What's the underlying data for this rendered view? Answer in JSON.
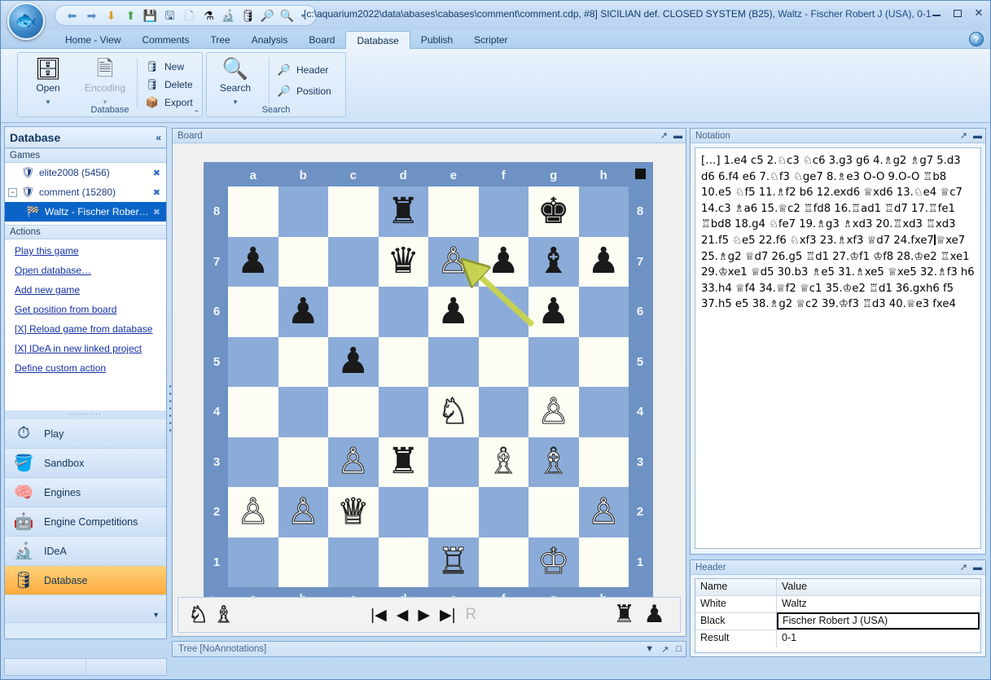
{
  "window": {
    "title_path": "[c:\\aquarium2022\\data\\abases\\cabases\\comment\\comment.cdp, #8] SICILIAN def. CLOSED SYSTEM (B25),",
    "title_players": "Waltz - Fischer Robert J (USA), 0-1",
    "minimize": "–",
    "maximize": "□",
    "close": "✕"
  },
  "quick_access": {
    "icons": [
      {
        "name": "back-arrow-icon",
        "glyph": "⬅"
      },
      {
        "name": "forward-arrow-icon",
        "glyph": "➡"
      },
      {
        "name": "download-arrow-icon",
        "glyph": "⬇"
      },
      {
        "name": "upload-arrow-icon",
        "glyph": "⬆"
      },
      {
        "name": "save-icon",
        "glyph": "💾"
      },
      {
        "name": "save-as-icon",
        "glyph": "🖫"
      },
      {
        "name": "new-document-icon",
        "glyph": "🗋"
      },
      {
        "name": "chart-flask-icon",
        "glyph": "⚗"
      },
      {
        "name": "microscope-icon",
        "glyph": "🔬"
      },
      {
        "name": "database-icon",
        "glyph": "🛢"
      },
      {
        "name": "search-header-icon",
        "glyph": "🔎"
      },
      {
        "name": "search-ab-icon",
        "glyph": "🔍"
      }
    ],
    "dropdown_glyph": "▾"
  },
  "ribbon": {
    "tabs": [
      {
        "label": "Home - View",
        "active": false
      },
      {
        "label": "Comments",
        "active": false
      },
      {
        "label": "Tree",
        "active": false
      },
      {
        "label": "Analysis",
        "active": false
      },
      {
        "label": "Board",
        "active": false
      },
      {
        "label": "Database",
        "active": true
      },
      {
        "label": "Publish",
        "active": false
      },
      {
        "label": "Scripter",
        "active": false
      }
    ],
    "help_glyph": "?",
    "groups": [
      {
        "name": "Database",
        "title": "Database",
        "dialog_launcher": "⌁",
        "big_buttons": [
          {
            "label": "Open",
            "icon": "database-open-icon",
            "glyph": "🗄",
            "dropdown": "▾",
            "disabled": false
          },
          {
            "label": "Encoding",
            "icon": "encoding-icon",
            "glyph": "🗎",
            "dropdown": "▾",
            "disabled": true
          }
        ],
        "small_buttons": [
          {
            "label": "New",
            "icon": "new-database-icon",
            "glyph": "🛢"
          },
          {
            "label": "Delete",
            "icon": "delete-database-icon",
            "glyph": "🛢"
          },
          {
            "label": "Export",
            "icon": "export-icon",
            "glyph": "📦"
          }
        ]
      },
      {
        "name": "Search",
        "title": "Search",
        "big_buttons": [
          {
            "label": "Search",
            "icon": "search-magnifier-icon",
            "glyph": "🔍",
            "dropdown": "▾",
            "disabled": false
          }
        ],
        "small_buttons": [
          {
            "label": "Header",
            "icon": "search-header-icon",
            "glyph": "🔎"
          },
          {
            "label": "Position",
            "icon": "search-position-icon",
            "glyph": "🔎"
          }
        ]
      }
    ]
  },
  "sidebar": {
    "title": "Database",
    "collapse_glyph": "«",
    "games_section": "Games",
    "games": [
      {
        "label": "elite2008 (5456)",
        "icon": "database-games-icon",
        "glyph": "🛡",
        "expander": "",
        "close": "✖",
        "selected": false,
        "indent": false
      },
      {
        "label": "comment (15280)",
        "icon": "database-games-icon",
        "glyph": "🛡",
        "expander": "−",
        "close": "✖",
        "selected": false,
        "indent": false
      },
      {
        "label": "Waltz - Fischer Rober…",
        "icon": "game-icon",
        "glyph": "🏁",
        "expander": "",
        "close": "✖",
        "selected": true,
        "indent": true
      }
    ],
    "actions_section": "Actions",
    "actions": [
      {
        "prefix": "",
        "label": "Play this game"
      },
      {
        "prefix": "",
        "label": "Open database…"
      },
      {
        "prefix": "",
        "label": "Add new game"
      },
      {
        "prefix": "",
        "label": "Get position from board"
      },
      {
        "prefix": "[X] ",
        "label": "Reload game from database"
      },
      {
        "prefix": "[X] ",
        "label": "IDeA in new linked project"
      },
      {
        "prefix": "",
        "label": "Define custom action"
      }
    ],
    "nav_items": [
      {
        "label": "Play",
        "icon": "chess-clock-icon",
        "glyph": "⏱",
        "active": false
      },
      {
        "label": "Sandbox",
        "icon": "sandbox-bucket-icon",
        "glyph": "🪣",
        "active": false
      },
      {
        "label": "Engines",
        "icon": "brain-gear-icon",
        "glyph": "🧠",
        "active": false
      },
      {
        "label": "Engine Competitions",
        "icon": "engine-versus-icon",
        "glyph": "🤖",
        "active": false
      },
      {
        "label": "IDeA",
        "icon": "microscope-icon",
        "glyph": "🔬",
        "active": false
      },
      {
        "label": "Database",
        "icon": "database-chess-icon",
        "glyph": "🛢",
        "active": true
      }
    ],
    "nav_more_glyph": "▼"
  },
  "board_panel": {
    "title": "Board",
    "tools": [
      "↗",
      "▬"
    ],
    "files": [
      "a",
      "b",
      "c",
      "d",
      "e",
      "f",
      "g",
      "h"
    ],
    "ranks": [
      "8",
      "7",
      "6",
      "5",
      "4",
      "3",
      "2",
      "1"
    ],
    "side_to_move": "black",
    "flip_icon": "↻",
    "position": [
      [
        "",
        "",
        "",
        "r",
        "",
        "",
        "k",
        ""
      ],
      [
        "p",
        "",
        "",
        "q",
        "P",
        "p",
        "b",
        "p"
      ],
      [
        "",
        "p",
        "",
        "",
        "p",
        "",
        "p",
        ""
      ],
      [
        "",
        "",
        "p",
        "",
        "",
        "",
        "",
        ""
      ],
      [
        "",
        "",
        "",
        "",
        "N",
        "",
        "P",
        ""
      ],
      [
        "",
        "",
        "P",
        "r",
        "",
        "B",
        "B",
        ""
      ],
      [
        "P",
        "P",
        "Q",
        "",
        "",
        "",
        "",
        "P"
      ],
      [
        "",
        "",
        "",
        "",
        "R",
        "",
        "K",
        ""
      ]
    ],
    "move_arrow": {
      "from": "g6",
      "to": "e7",
      "color": "#c8d44a"
    },
    "toolbar": {
      "left_icons": [
        {
          "name": "white-knight-icon",
          "glyph": "♘"
        },
        {
          "name": "white-bishop-icon",
          "glyph": "♗"
        }
      ],
      "nav_buttons": [
        {
          "name": "first-move-button",
          "glyph": "|◀"
        },
        {
          "name": "previous-move-button",
          "glyph": "◀"
        },
        {
          "name": "next-move-button",
          "glyph": "▶"
        },
        {
          "name": "last-move-button",
          "glyph": "▶|"
        },
        {
          "name": "replay-button",
          "glyph": "R",
          "disabled": true
        }
      ],
      "right_icons": [
        {
          "name": "black-rook-icon",
          "glyph": "♜"
        },
        {
          "name": "black-pawn-icon",
          "glyph": "♟"
        }
      ]
    }
  },
  "tree_strip": {
    "label": "Tree [NoAnnotations]",
    "tools": [
      "▼",
      "↗",
      "□"
    ]
  },
  "notation_panel": {
    "title": "Notation",
    "tools": [
      "↗",
      "▬"
    ],
    "text_before_caret": "[…] 1.e4 c5 2.♘c3 ♘c6 3.g3 g6 4.♗g2 ♗g7 5.d3 d6 6.f4 e6 7.♘f3 ♘ge7 8.♗e3 O-O 9.O-O ♖b8 10.e5 ♘f5 11.♗f2 b6 12.exd6 ♕xd6 13.♘e4 ♕c7 14.c3 ♗a6 15.♕c2 ♖fd8 16.♖ad1 ♖d7 17.♖fe1 ♖bd8 18.g4 ♘fe7 19.♗g3 ♗xd3 20.♖xd3 ♖xd3 21.f5 ♘e5 22.f6 ♘xf3 23.♗xf3 ♕d7 24.fxe7",
    "text_after_caret": "♕xe7 25.♗g2 ♕d7 26.g5 ♖d1 27.♔f1 ♔f8 28.♔e2 ♖xe1 29.♔xe1 ♕d5 30.b3 ♗e5 31.♗xe5 ♕xe5 32.♗f3 h6 33.h4 ♕f4 34.♕f2 ♕c1 35.♔e2 ♖d1 36.gxh6 f5 37.h5 e5 38.♗g2 ♕c2 39.♔f3 ♖d3 40.♕e3 fxe4"
  },
  "header_panel": {
    "title": "Header",
    "tools": [
      "↗",
      "▬"
    ],
    "columns": [
      "Name",
      "Value"
    ],
    "rows": [
      {
        "name": "White",
        "value": "Waltz",
        "focused": false
      },
      {
        "name": "Black",
        "value": "Fischer Robert J (USA)",
        "focused": true
      },
      {
        "name": "Result",
        "value": "0-1",
        "focused": false
      }
    ]
  },
  "colors": {
    "accent": "#0a64c8",
    "board_light": "#fdfdf4",
    "board_dark": "#8bacd8",
    "board_border": "#6e92c4",
    "nav_active": "#ffab3d",
    "link": "#1330a8"
  }
}
